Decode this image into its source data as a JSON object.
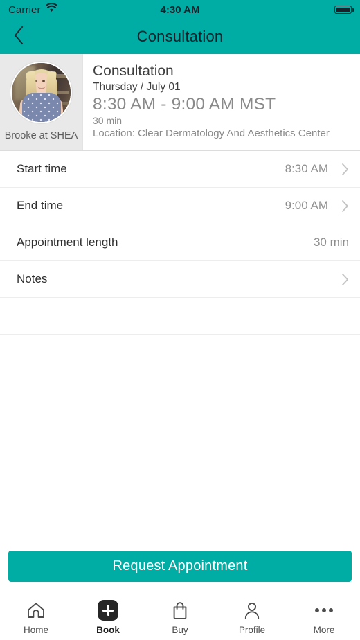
{
  "status_bar": {
    "carrier": "Carrier",
    "wifi_icon": "wifi-icon",
    "time": "4:30 AM",
    "battery_icon": "battery-full-icon"
  },
  "nav_bar": {
    "back_icon": "chevron-left-icon",
    "title": "Consultation"
  },
  "appointment": {
    "provider_name": "Brooke at SHEA",
    "avatar_icon": "provider-avatar-photo",
    "title": "Consultation",
    "date": "Thursday / July 01",
    "time_range": "8:30 AM - 9:00 AM MST",
    "duration": "30 min",
    "location": "Location: Clear Dermatology And Aesthetics Center"
  },
  "details": {
    "rows": [
      {
        "label": "Start time",
        "value": "8:30 AM",
        "chevron": true
      },
      {
        "label": "End time",
        "value": "9:00 AM",
        "chevron": true
      },
      {
        "label": "Appointment length",
        "value": "30 min",
        "chevron": false
      },
      {
        "label": "Notes",
        "value": "",
        "chevron": true
      }
    ]
  },
  "cta": {
    "label": "Request Appointment"
  },
  "tab_bar": {
    "items": [
      {
        "label": "Home",
        "icon": "home-icon",
        "active": false
      },
      {
        "label": "Book",
        "icon": "plus-icon",
        "active": true
      },
      {
        "label": "Buy",
        "icon": "bag-icon",
        "active": false
      },
      {
        "label": "Profile",
        "icon": "person-icon",
        "active": false
      },
      {
        "label": "More",
        "icon": "ellipsis-icon",
        "active": false
      }
    ]
  },
  "colors": {
    "accent_teal": "#00ada5",
    "status_text": "#15222b",
    "row_label": "#2f2f2f",
    "row_value": "#8e8e8e",
    "avatar_panel": "#e9e9e9",
    "tab_active": "#1c1c1c"
  }
}
